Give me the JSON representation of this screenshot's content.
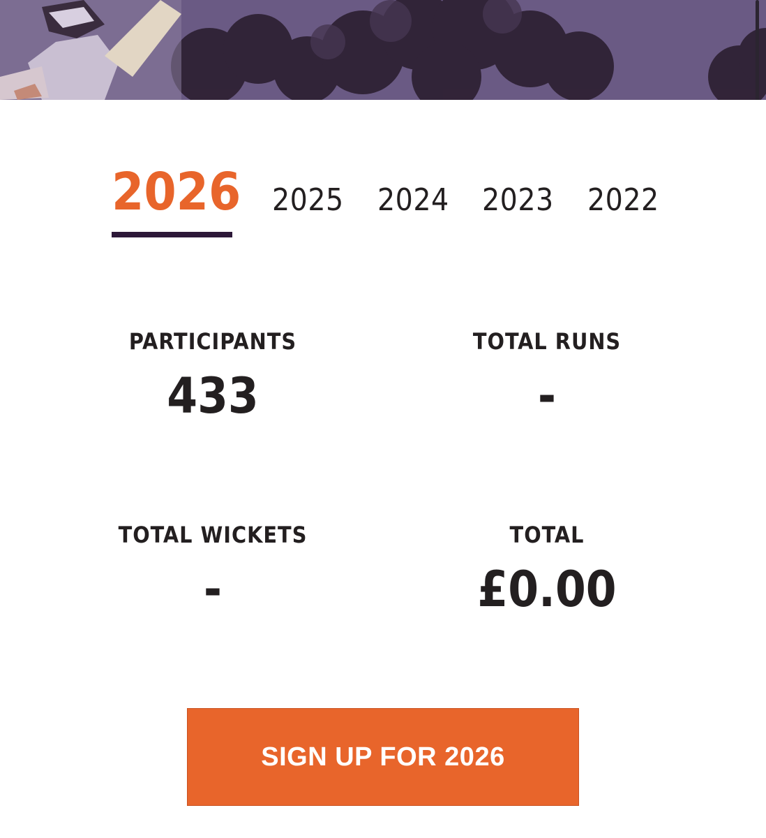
{
  "hero": {
    "image_description_icon": "cricket-batsman-photo"
  },
  "year_tabs": {
    "items": [
      {
        "label": "2026",
        "active": true
      },
      {
        "label": "2025",
        "active": false
      },
      {
        "label": "2024",
        "active": false
      },
      {
        "label": "2023",
        "active": false
      },
      {
        "label": "2022",
        "active": false
      }
    ]
  },
  "stats": {
    "participants": {
      "label": "PARTICIPANTS",
      "value": "433"
    },
    "total_runs": {
      "label": "TOTAL RUNS",
      "value": "-"
    },
    "total_wickets": {
      "label": "TOTAL WICKETS",
      "value": "-"
    },
    "total": {
      "label": "TOTAL",
      "value": "£0.00"
    }
  },
  "cta": {
    "label": "SIGN UP FOR 2026"
  },
  "colors": {
    "accent": "#e8652b",
    "dark_purple": "#2d1838",
    "text": "#231f20"
  }
}
